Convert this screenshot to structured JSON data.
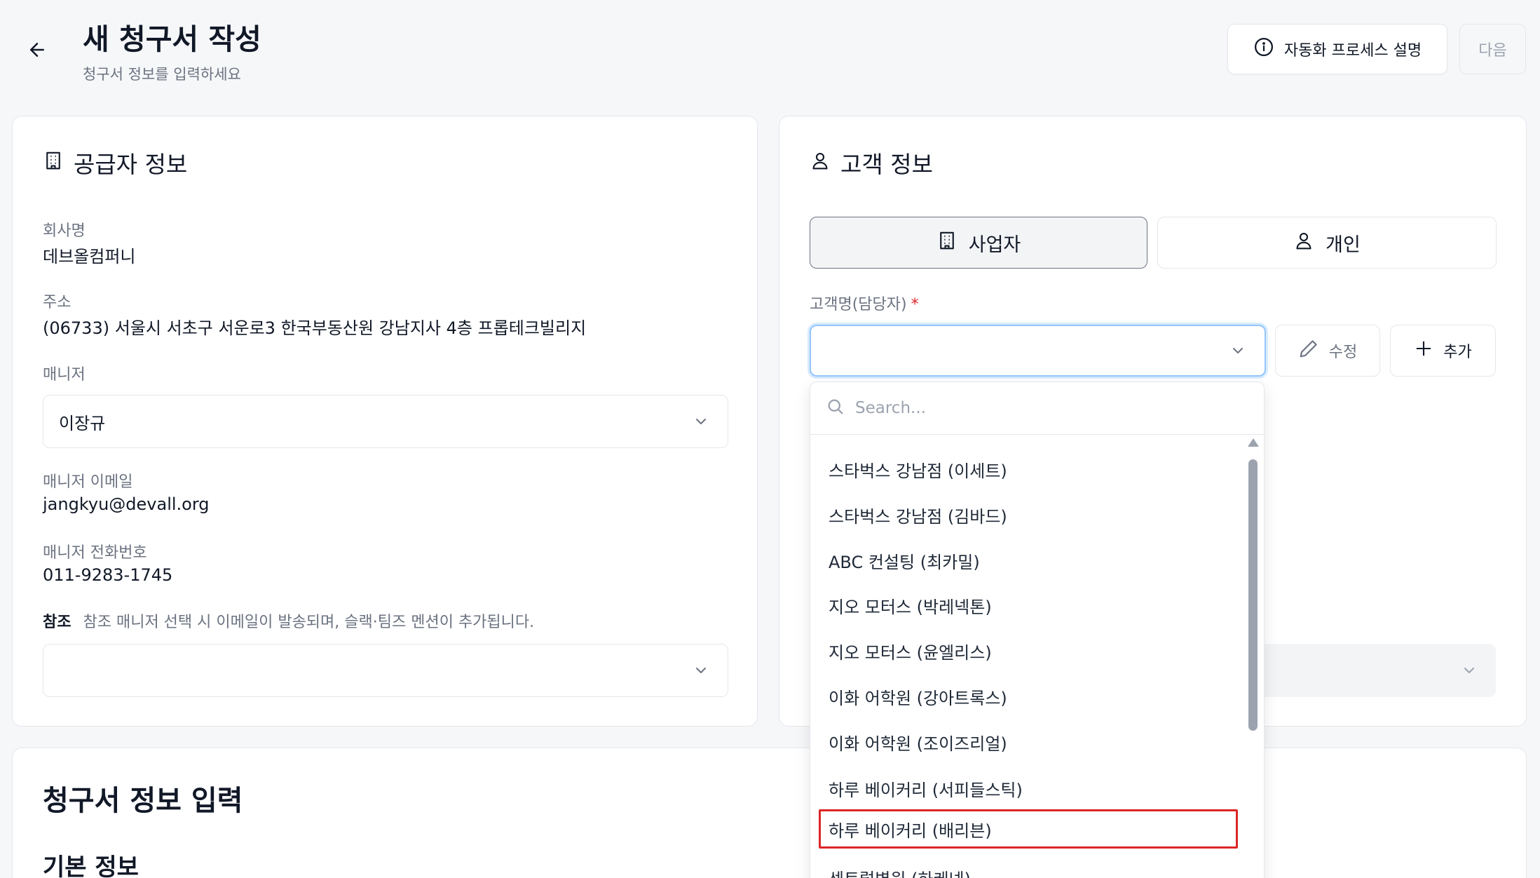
{
  "header": {
    "title": "새 청구서 작성",
    "subtitle": "청구서 정보를 입력하세요",
    "help_button": "자동화 프로세스 설명",
    "next_button": "다음"
  },
  "supplier": {
    "title": "공급자 정보",
    "company_label": "회사명",
    "company_value": "데브올컴퍼니",
    "address_label": "주소",
    "address_value": "(06733) 서울시 서초구 서운로3 한국부동산원 강남지사 4층 프롭테크빌리지",
    "manager_label": "매니저",
    "manager_value": "이장규",
    "manager_email_label": "매니저 이메일",
    "manager_email_value": "jangkyu@devall.org",
    "manager_phone_label": "매니저 전화번호",
    "manager_phone_value": "011-9283-1745",
    "note_label": "참조",
    "note_text": "참조 매니저 선택 시 이메일이 발송되며, 슬랙·팀즈 멘션이 추가됩니다.",
    "note_select_value": ""
  },
  "customer": {
    "title": "고객 정보",
    "segment_business": "사업자",
    "segment_personal": "개인",
    "segment_selected": "사업자",
    "name_label": "고객명(담당자)",
    "required_mark": "*",
    "name_value": "",
    "edit_button": "수정",
    "add_button": "추가"
  },
  "dropdown": {
    "search_placeholder": "Search...",
    "options": [
      "스타벅스 강남점 (이세트)",
      "스타벅스 강남점 (김바드)",
      "ABC 컨설팅 (최카밀)",
      "지오 모터스 (박레넥톤)",
      "지오 모터스 (윤엘리스)",
      "이화 어학원 (강아트록스)",
      "이화 어학원 (조이즈리얼)",
      "하루 베이커리 (서피들스틱)",
      "하루 베이커리 (배리븐)",
      "센트럴병원 (하케넨)"
    ],
    "highlighted_index": 8
  },
  "invoice": {
    "title": "청구서 정보 입력",
    "section_basic": "기본 정보"
  },
  "colors": {
    "background": "#f6f7f9",
    "accent_focus": "#93c5fd",
    "required": "#dc2626",
    "highlight_box": "#dc2626"
  },
  "icons": {
    "back": "arrow-left-icon",
    "help": "info-icon",
    "supplier": "building-icon",
    "customer": "user-icon",
    "edit": "pencil-icon",
    "add": "plus-icon",
    "search": "search-icon",
    "dropdown": "chevron-down-icon"
  }
}
